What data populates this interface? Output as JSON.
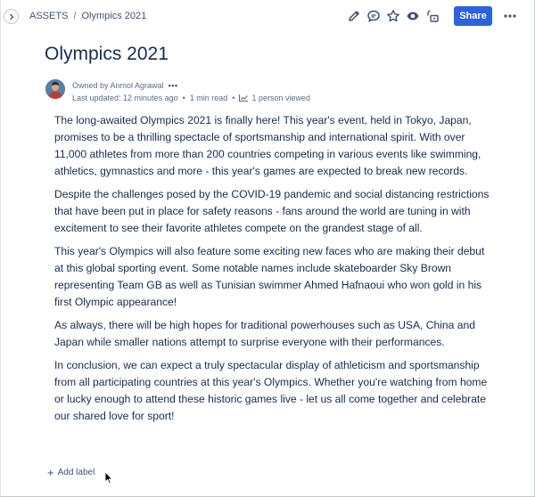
{
  "breadcrumb": {
    "root": "ASSETS",
    "separator": "/",
    "current": "Olympics 2021"
  },
  "toolbar": {
    "icons": [
      "edit-icon",
      "comment-icon",
      "star-icon",
      "watch-icon",
      "restrictions-icon"
    ],
    "share_label": "Share",
    "more_label": "•••"
  },
  "page": {
    "title": "Olympics 2021"
  },
  "byline": {
    "owner": "Owned by Anmol Agrawal",
    "more": "•••",
    "updated": "Last updated: 12 minutes ago",
    "read_time": "1 min read",
    "viewed": "1 person viewed",
    "separator": "•"
  },
  "content": {
    "paragraphs": [
      "The long-awaited Olympics 2021 is finally here! This year's event, held in Tokyo, Japan, promises to be a thrilling spectacle of sportsmanship and international spirit. With over 11,000 athletes from more than 200 countries competing in various events like swimming, athletics, gymnastics and more - this year's games are expected to break new records.",
      "Despite the challenges posed by the COVID-19 pandemic and social distancing restrictions that have been put in place for safety reasons - fans around the world are tuning in with excitement to see their favorite athletes compete on the grandest stage of all.",
      "This year's Olympics will also feature some exciting new faces who are making their debut at this global sporting event. Some notable names include skateboarder Sky Brown representing Team GB as well as Tunisian swimmer Ahmed Hafnaoui who won gold in his first Olympic appearance!",
      "As always, there will be high hopes for traditional powerhouses such as USA, China and Japan while smaller nations attempt to surprise everyone with their performances.",
      "In conclusion, we can expect a truly spectacular display of athleticism and sportsmanship from all participating countries at this year's Olympics. Whether you're watching from home or lucky enough to attend these historic games live - let us all come together and celebrate our shared love for sport!"
    ]
  },
  "labels": {
    "add_label": "Add label",
    "plus": "+"
  },
  "colors": {
    "accent": "#2d62d8",
    "text": "#172b4d",
    "subtle": "#5e6c84"
  }
}
